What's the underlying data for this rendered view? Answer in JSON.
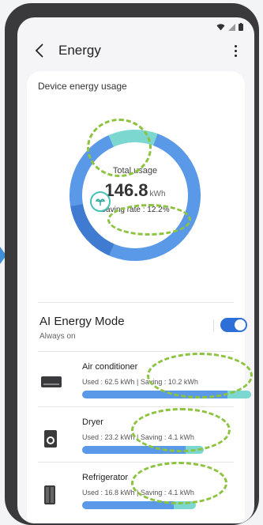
{
  "status": {
    "icons": [
      "wifi-icon",
      "signal-icon",
      "battery-icon"
    ]
  },
  "appbar": {
    "title": "Energy"
  },
  "card": {
    "label": "Device energy usage"
  },
  "usage": {
    "total_label": "Total usage",
    "total_value": "146.8",
    "total_unit": "kWh",
    "saving_rate": "Saving rate : 12.2%",
    "used_fraction": 0.878,
    "saving_fraction": 0.122
  },
  "ai": {
    "title": "AI Energy Mode",
    "subtitle": "Always on",
    "enabled": true
  },
  "devices": [
    {
      "name": "Air conditioner",
      "used": "Used : 62.5 kWh",
      "saving": "Saving : 10.2 kWh",
      "used_kwh": 62.5,
      "saving_kwh": 10.2
    },
    {
      "name": "Dryer",
      "used": "Used : 23.2 kWh",
      "saving": "Saving : 4.1 kWh",
      "used_kwh": 23.2,
      "saving_kwh": 4.1
    },
    {
      "name": "Refrigerator",
      "used": "Used : 16.8 kWh",
      "saving": "Saving : 4.1 kWh",
      "used_kwh": 16.8,
      "saving_kwh": 4.1
    }
  ],
  "colors": {
    "accent": "#2d6fd7",
    "used": "#5a98e8",
    "saving": "#7dd7d1",
    "highlight": "#8cc33f"
  }
}
